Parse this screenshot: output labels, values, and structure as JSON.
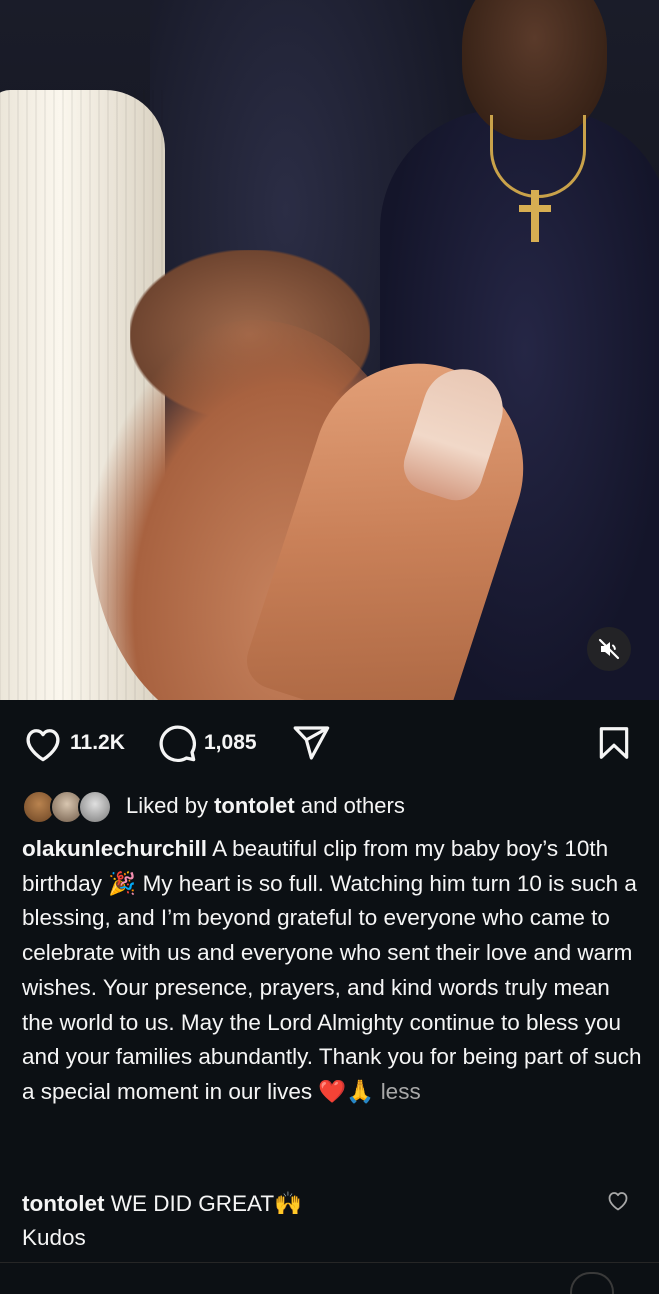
{
  "video": {
    "mute_icon": "speaker-muted-icon"
  },
  "actions": {
    "like_count": "11.2K",
    "comment_count": "1,085",
    "icons": {
      "like": "heart-icon",
      "comment": "comment-bubble-icon",
      "share": "paper-plane-icon",
      "save": "bookmark-icon"
    }
  },
  "liked_by": {
    "prefix": "Liked by",
    "user": "tontolet",
    "suffix": "and others"
  },
  "post": {
    "username": "olakunlechurchill",
    "caption": "A beautiful clip from my baby boy’s 10th birthday 🎉 My heart is so full. Watching him turn 10 is such a blessing, and I’m beyond grateful to everyone who came to celebrate with us and everyone who sent their love and warm wishes. Your presence, prayers, and kind words truly mean the world to us. May the Lord Almighty continue to bless you and your families abundantly. Thank you for being part of such a special moment in our lives ❤️🙏",
    "less_label": "less"
  },
  "comment": {
    "username": "tontolet",
    "text": "WE DID GREAT🙌",
    "text_line2": "Kudos",
    "like_icon": "heart-outline-icon"
  },
  "colors": {
    "background": "#0c1014",
    "text": "#f5f5f5",
    "muted": "#a8a8a8"
  }
}
